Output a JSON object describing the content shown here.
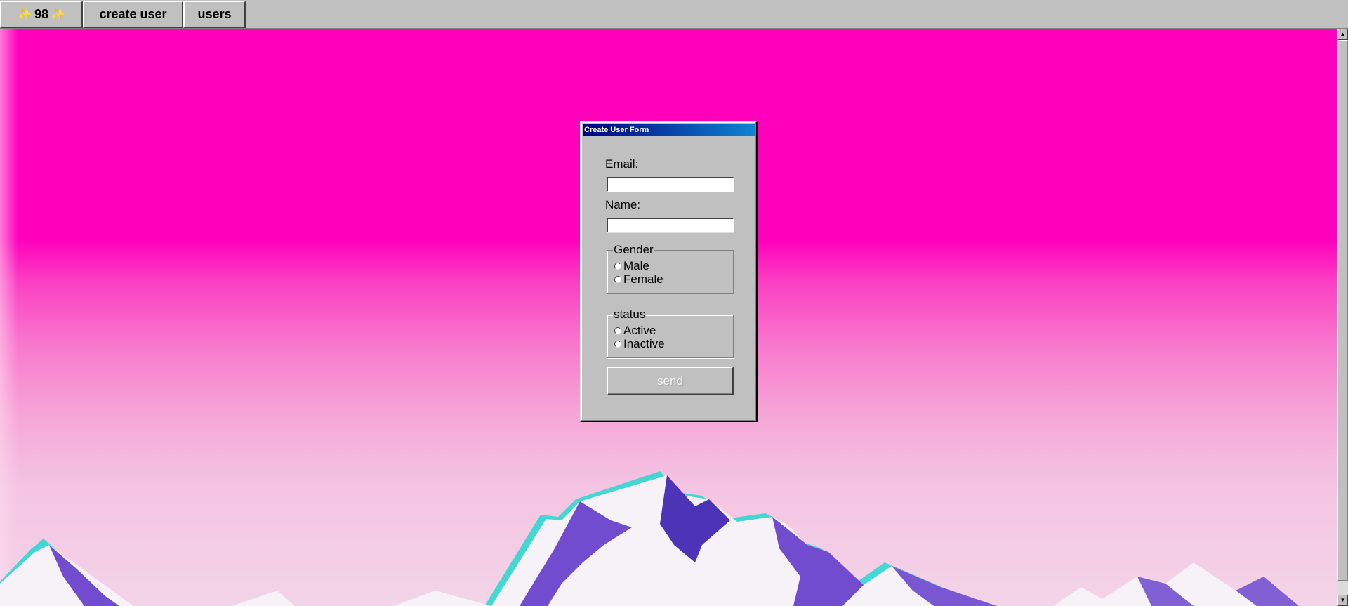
{
  "taskbar": {
    "start_label": "98",
    "create_user_label": "create user",
    "users_label": "users"
  },
  "window": {
    "title": "Create User Form",
    "email_label": "Email:",
    "email_value": "",
    "name_label": "Name:",
    "name_value": "",
    "gender": {
      "legend": "Gender",
      "options": [
        "Male",
        "Female"
      ]
    },
    "status": {
      "legend": "status",
      "options": [
        "Active",
        "Inactive"
      ]
    },
    "send_label": "send"
  },
  "colors": {
    "sky": "#ff00bb",
    "horizon": "#f3d4e8",
    "window_face": "#c0c0c0",
    "titlebar_start": "#000080",
    "titlebar_end": "#1084d0"
  },
  "icons": {
    "sparkle": "sparkles-icon"
  }
}
